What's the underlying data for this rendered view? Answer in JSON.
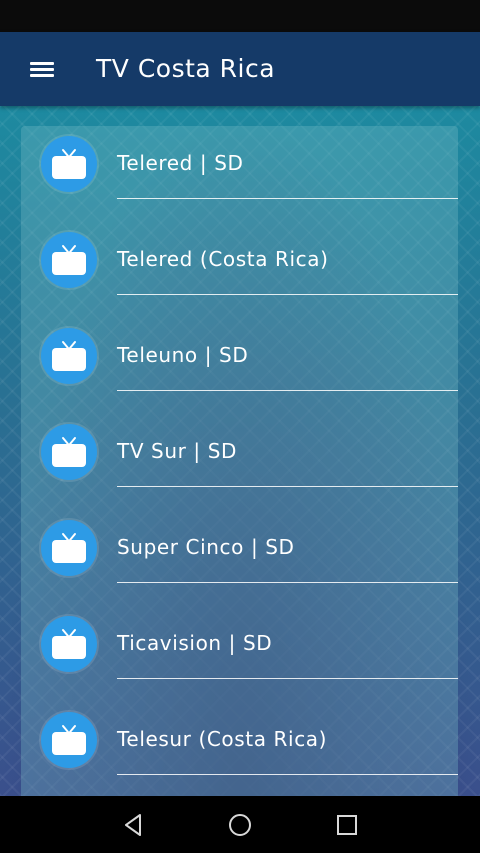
{
  "app": {
    "title": "TV Costa Rica",
    "menu_icon": "hamburger-menu-icon"
  },
  "channels": [
    {
      "label": "Telered | SD",
      "icon": "tv-icon"
    },
    {
      "label": "Telered (Costa Rica)",
      "icon": "tv-icon"
    },
    {
      "label": "Teleuno | SD",
      "icon": "tv-icon"
    },
    {
      "label": "TV Sur | SD",
      "icon": "tv-icon"
    },
    {
      "label": "Super Cinco | SD",
      "icon": "tv-icon"
    },
    {
      "label": "Ticavision | SD",
      "icon": "tv-icon"
    },
    {
      "label": "Telesur (Costa Rica)",
      "icon": "tv-icon"
    }
  ],
  "navigation": {
    "back_icon": "back-triangle-icon",
    "home_icon": "home-circle-icon",
    "recents_icon": "recents-square-icon"
  },
  "colors": {
    "app_bar": "#153a68",
    "icon_badge": "#2d9be6",
    "text": "#ffffff"
  }
}
